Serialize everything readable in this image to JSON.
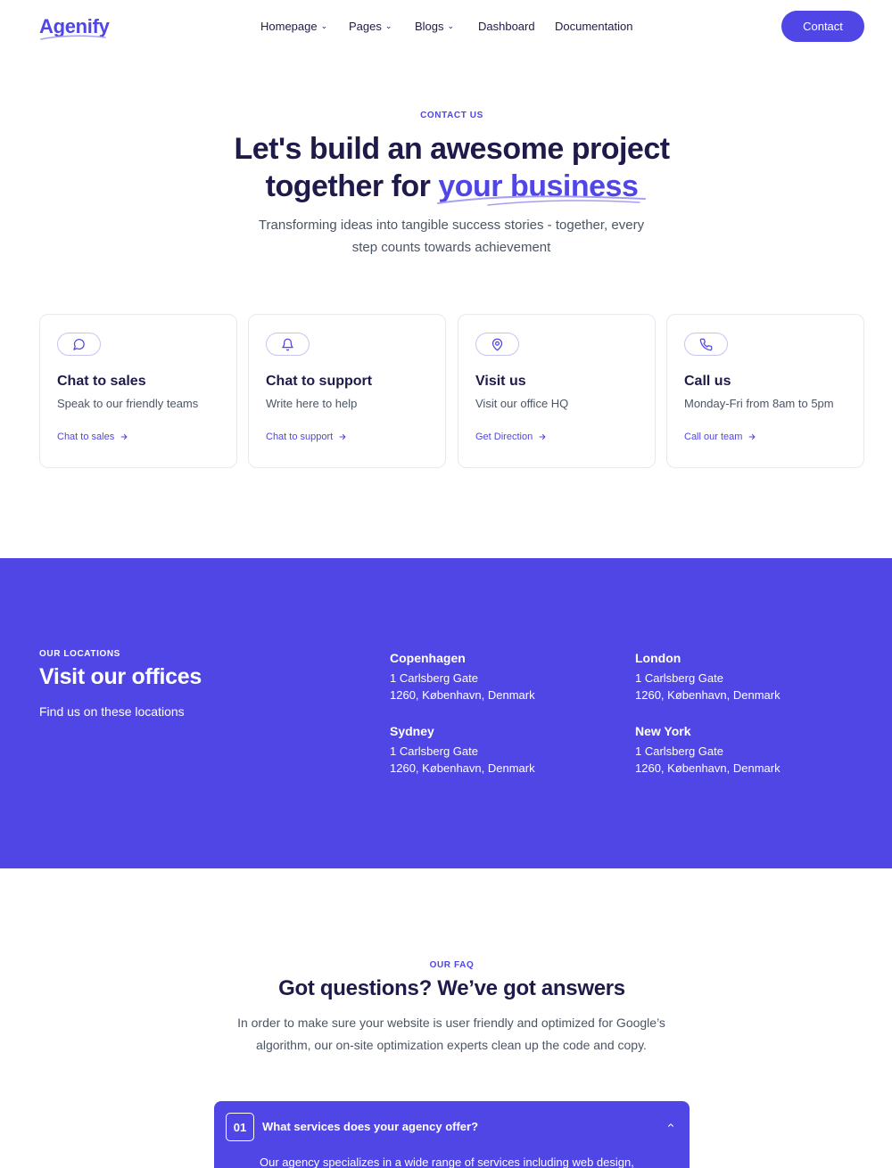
{
  "brand": {
    "name": "Agenify",
    "accent": "#4f46e5",
    "dark": "#1e1b4b"
  },
  "nav": {
    "links": [
      {
        "label": "Homepage",
        "dropdown": true
      },
      {
        "label": "Pages",
        "dropdown": true
      },
      {
        "label": "Blogs",
        "dropdown": true
      },
      {
        "label": "Dashboard",
        "dropdown": false
      },
      {
        "label": "Documentation",
        "dropdown": false
      }
    ],
    "cta": "Contact"
  },
  "hero": {
    "eyebrow": "CONTACT US",
    "title_line1": "Let's build an awesome project",
    "title_line2_prefix": "together for",
    "title_highlight": "your business",
    "subtitle": "Transforming ideas into tangible success stories - together, every step counts towards achievement"
  },
  "cards": [
    {
      "icon": "chat-bubble-icon",
      "title": "Chat to sales",
      "description": "Speak to our friendly teams",
      "link": "Chat to sales"
    },
    {
      "icon": "bell-icon",
      "title": "Chat to support",
      "description": "Write here to help",
      "link": "Chat to support"
    },
    {
      "icon": "map-pin-icon",
      "title": "Visit us",
      "description": "Visit our office HQ",
      "link": "Get Direction"
    },
    {
      "icon": "phone-icon",
      "title": "Call us",
      "description": "Monday-Fri from 8am to 5pm",
      "link": "Call our team"
    }
  ],
  "locations": {
    "eyebrow": "OUR LOCATIONS",
    "title": "Visit our offices",
    "subtitle": "Find us on these locations",
    "offices": [
      {
        "city": "Copenhagen",
        "street": "1 Carlsberg Gate",
        "postal": "1260, København, Denmark"
      },
      {
        "city": "London",
        "street": "1 Carlsberg Gate",
        "postal": "1260, København, Denmark"
      },
      {
        "city": "Sydney",
        "street": "1 Carlsberg Gate",
        "postal": "1260, København, Denmark"
      },
      {
        "city": "New York",
        "street": "1 Carlsberg Gate",
        "postal": "1260, København, Denmark"
      }
    ]
  },
  "faq": {
    "eyebrow": "OUR FAQ",
    "title": "Got questions? We’ve got answers",
    "subtitle": "In order to make sure your website is user friendly and optimized for Google’s algorithm, our on-site optimization experts clean up the code and copy.",
    "items": [
      {
        "number": "01",
        "question": "What services does your agency offer?",
        "answer": "Our agency specializes in a wide range of services including web design,"
      }
    ]
  }
}
